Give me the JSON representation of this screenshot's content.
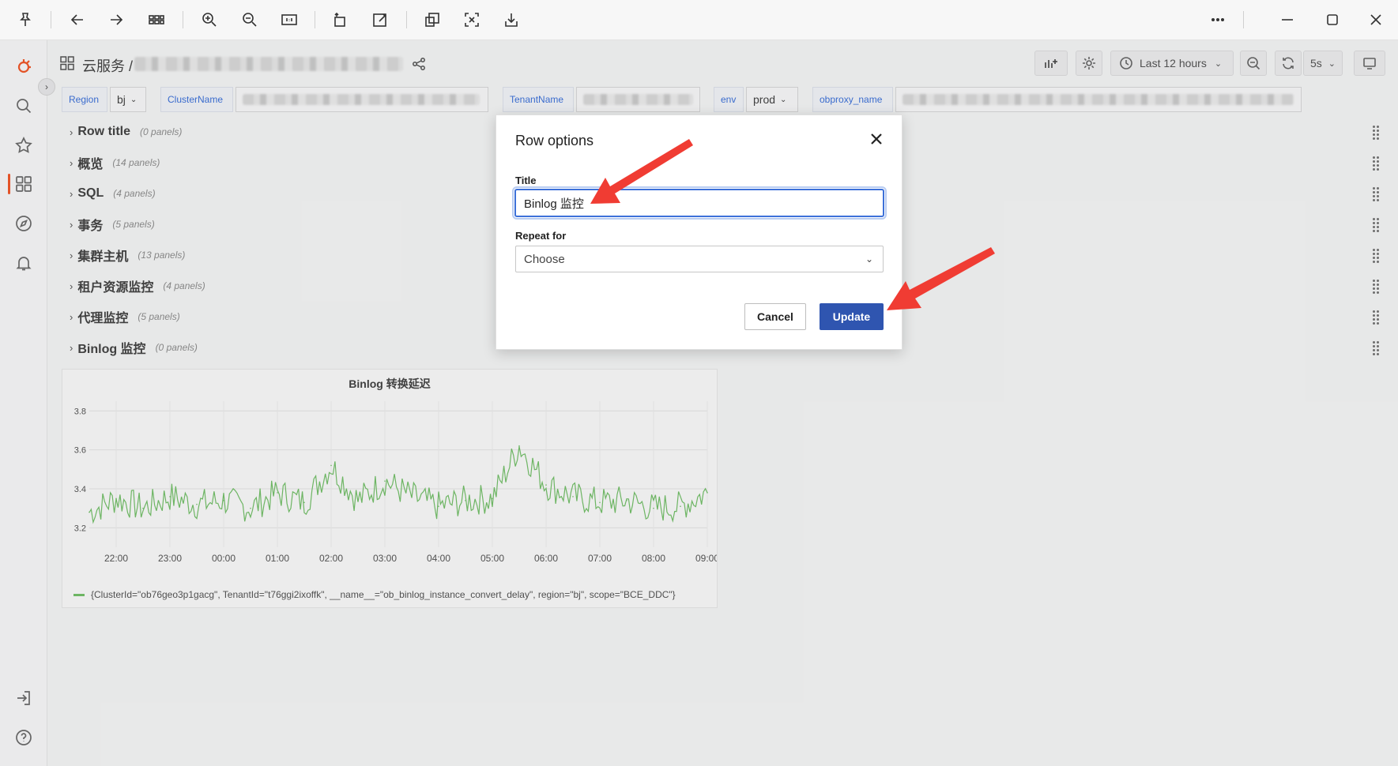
{
  "toolbar": {
    "icons": [
      "pin-icon",
      "back-icon",
      "forward-icon",
      "grid-view-icon",
      "zoom-in-icon",
      "zoom-out-icon",
      "actual-size-icon",
      "rotate-icon",
      "edit-icon",
      "ocr-icon",
      "crop-icon",
      "save-icon",
      "more-icon",
      "minimize-icon",
      "maximize-icon",
      "close-icon"
    ]
  },
  "sidebar": {
    "items": [
      "grafana-logo-icon",
      "search-icon",
      "starred-icon",
      "dashboards-icon",
      "explore-icon",
      "alerting-icon",
      "sign-in-icon",
      "help-icon"
    ]
  },
  "header": {
    "title": "云服务 /",
    "time_range": "Last 12 hours",
    "refresh_interval": "5s"
  },
  "variables": {
    "region_label": "Region",
    "region_value": "bj",
    "cluster_label": "ClusterName",
    "tenant_label": "TenantName",
    "env_label": "env",
    "env_value": "prod",
    "obproxy_label": "obproxy_name"
  },
  "rows": [
    {
      "title": "Row title",
      "count": "(0 panels)"
    },
    {
      "title": "概览",
      "count": "(14 panels)"
    },
    {
      "title": "SQL",
      "count": "(4 panels)"
    },
    {
      "title": "事务",
      "count": "(5 panels)"
    },
    {
      "title": "集群主机",
      "count": "(13 panels)"
    },
    {
      "title": "租户资源监控",
      "count": "(4 panels)"
    },
    {
      "title": "代理监控",
      "count": "(5 panels)"
    },
    {
      "title": "Binlog 监控",
      "count": "(0 panels)"
    }
  ],
  "panel": {
    "title": "Binlog 转换延迟",
    "legend": "{ClusterId=\"ob76geo3p1gacg\", TenantId=\"t76ggi2ixoffk\", __name__=\"ob_binlog_instance_convert_delay\", region=\"bj\", scope=\"BCE_DDC\"}"
  },
  "chart_data": {
    "type": "line",
    "title": "Binlog 转换延迟",
    "x_ticks": [
      "22:00",
      "23:00",
      "00:00",
      "01:00",
      "02:00",
      "03:00",
      "04:00",
      "05:00",
      "06:00",
      "07:00",
      "08:00",
      "09:00"
    ],
    "y_ticks": [
      "3.2",
      "3.4",
      "3.6",
      "3.8"
    ],
    "ylim": [
      3.1,
      3.85
    ],
    "series": [
      {
        "name": "{ClusterId=\"ob76geo3p1gacg\", TenantId=\"t76ggi2ixoffk\", __name__=\"ob_binlog_instance_convert_delay\", region=\"bj\", scope=\"BCE_DDC\"}",
        "color": "#73bf69",
        "x": [
          "21:30",
          "22:00",
          "22:30",
          "23:00",
          "23:30",
          "00:00",
          "00:30",
          "01:00",
          "01:30",
          "02:00",
          "02:30",
          "03:00",
          "03:30",
          "04:00",
          "04:30",
          "05:00",
          "05:30",
          "06:00",
          "06:30",
          "07:00",
          "07:30",
          "08:00",
          "08:30",
          "09:00"
        ],
        "y": [
          3.28,
          3.35,
          3.3,
          3.36,
          3.32,
          3.34,
          3.3,
          3.38,
          3.33,
          3.52,
          3.34,
          3.44,
          3.36,
          3.31,
          3.34,
          3.35,
          3.62,
          3.42,
          3.36,
          3.33,
          3.34,
          3.3,
          3.31,
          3.38
        ]
      }
    ],
    "grid": true,
    "legend": "bottom-left"
  },
  "modal": {
    "title": "Row options",
    "title_label": "Title",
    "title_value": "Binlog 监控",
    "repeat_label": "Repeat for",
    "repeat_value": "Choose",
    "cancel": "Cancel",
    "update": "Update"
  },
  "colors": {
    "accent": "#3d71d9",
    "primary_button": "#2f55b0",
    "series": "#73bf69",
    "annotation": "#f03c33"
  }
}
